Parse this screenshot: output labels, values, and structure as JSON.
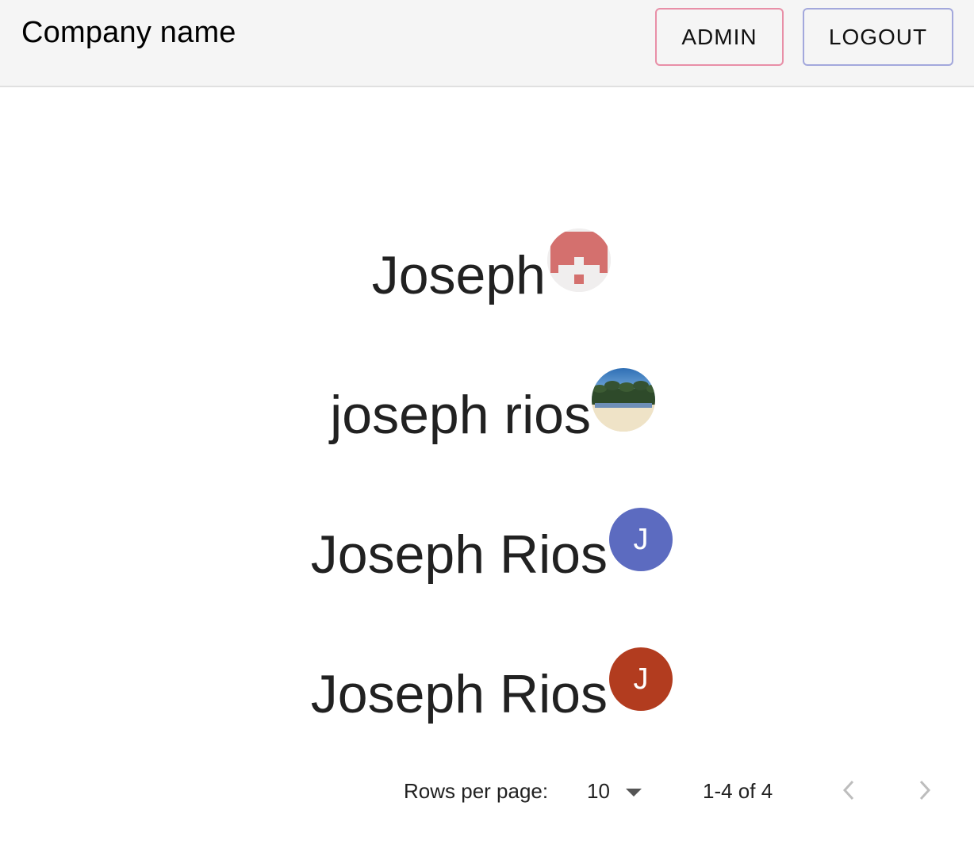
{
  "appbar": {
    "company_name": "Company name",
    "admin_label": "ADMIN",
    "logout_label": "LOGOUT"
  },
  "users": [
    {
      "name": "Joseph",
      "avatar": "identicon"
    },
    {
      "name": "joseph rios",
      "avatar": "beach-photo"
    },
    {
      "name": "Joseph Rios",
      "avatar": "letter",
      "initial": "J",
      "color": "#5c6bc0"
    },
    {
      "name": "Joseph Rios",
      "avatar": "letter",
      "initial": "J",
      "color": "#b23c1f"
    }
  ],
  "pagination": {
    "rows_per_page_label": "Rows per page:",
    "rows_per_page_value": "10",
    "range_text": "1-4 of 4",
    "prev_icon": "chevron-left-icon",
    "next_icon": "chevron-right-icon"
  },
  "colors": {
    "appbar_bg": "#f5f5f5",
    "admin_border": "#e88fa7",
    "logout_border": "#a3a8dc",
    "identicon_color": "#d4706e"
  }
}
